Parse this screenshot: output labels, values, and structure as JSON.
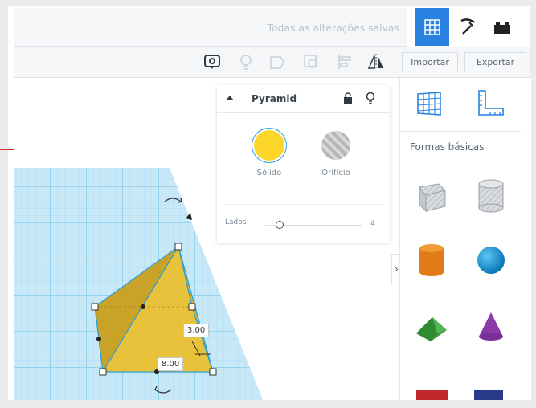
{
  "header": {
    "status": "Todas as alterações salvas",
    "modes": [
      "grid-view-icon",
      "pickaxe-icon",
      "brick-icon"
    ],
    "accent": "#2a82e0"
  },
  "toolbar": {
    "tools": [
      "notes-icon",
      "lightbulb-icon",
      "shape-outline-icon",
      "group-icon",
      "align-icon",
      "mirror-icon"
    ],
    "import_label": "Importar",
    "export_label": "Exportar"
  },
  "inspector": {
    "title": "Pyramid",
    "solid_label": "Sólido",
    "hole_label": "Orifício",
    "sides_label": "Lados",
    "sides_value": "4",
    "solid_color": "#fcd72a"
  },
  "panel": {
    "tabs": [
      "workplane-icon",
      "ruler-icon"
    ],
    "category": "Formas básicas",
    "shapes": [
      "box-hole",
      "cylinder-hole",
      "cylinder",
      "sphere",
      "roof",
      "cone"
    ]
  },
  "workplane": {
    "dimension_height": "3.00",
    "dimension_width": "8.00",
    "grid_color": "#bfe3f4"
  }
}
